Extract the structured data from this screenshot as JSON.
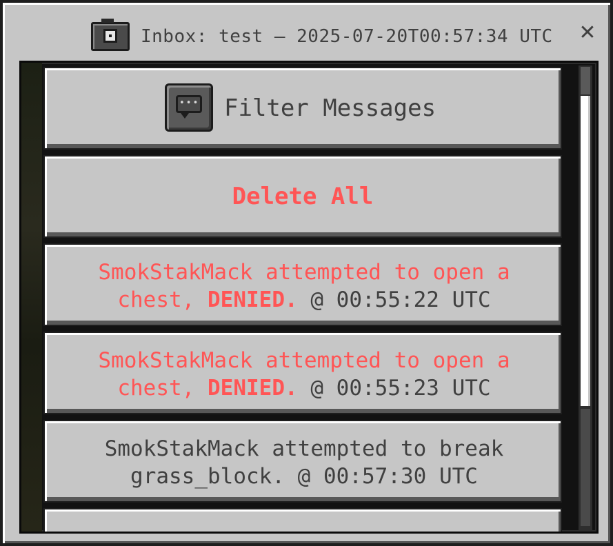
{
  "window": {
    "title": "Inbox: test – 2025-07-20T00:57:34 UTC",
    "close_glyph": "✕",
    "icon": "camera-icon"
  },
  "filter": {
    "label": "Filter Messages",
    "icon": "chat-bubble-icon"
  },
  "delete_all": {
    "label": "Delete All",
    "color": "#ff5555"
  },
  "messages": [
    {
      "line1": "SmokStakMack attempted to open a",
      "line2_prefix": "chest, ",
      "status": "DENIED.",
      "time": " @ 00:55:22 UTC",
      "color": "#ff5555"
    },
    {
      "line1": "SmokStakMack attempted to open a",
      "line2_prefix": "chest, ",
      "status": "DENIED.",
      "time": " @ 00:55:23 UTC",
      "color": "#ff5555"
    },
    {
      "line1": "SmokStakMack attempted to break",
      "line2": "grass_block. @ 00:57:30 UTC",
      "color": "#404040"
    }
  ],
  "colors": {
    "panel": "#c6c6c6",
    "text": "#404040",
    "alert": "#ff5555"
  }
}
